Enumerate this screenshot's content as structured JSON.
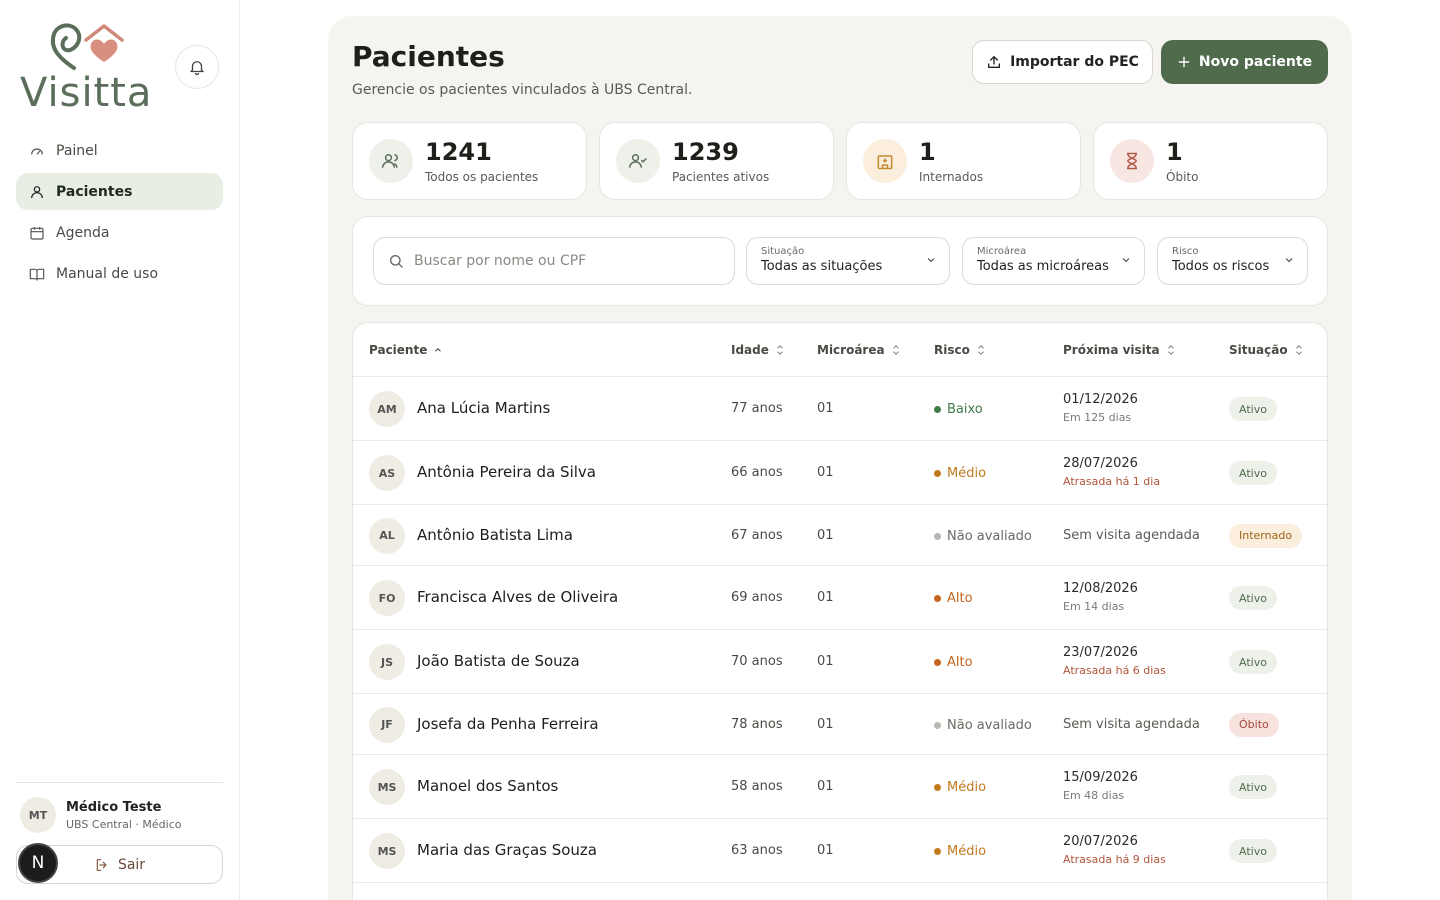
{
  "app": {
    "name": "Visitta"
  },
  "colors": {
    "accent": "#4f6b4b",
    "late": "#b0553a",
    "baixo": "#3f7a4a",
    "medio": "#c07a1e",
    "alto": "#c4641e",
    "nao": "#b8b6b0"
  },
  "sidebar": {
    "items": [
      {
        "label": "Painel",
        "icon": "gauge-icon"
      },
      {
        "label": "Pacientes",
        "icon": "user-icon"
      },
      {
        "label": "Agenda",
        "icon": "calendar-icon"
      },
      {
        "label": "Manual de uso",
        "icon": "book-icon"
      }
    ],
    "user": {
      "initials": "MT",
      "name": "Médico Teste",
      "role": "UBS Central · Médico"
    },
    "logout_label": "Sair",
    "badge": "N"
  },
  "header": {
    "title": "Pacientes",
    "subtitle": "Gerencie os pacientes vinculados à UBS Central.",
    "import_label": "Importar do PEC",
    "new_label": "Novo paciente"
  },
  "stats": [
    {
      "value": "1241",
      "label": "Todos os pacientes"
    },
    {
      "value": "1239",
      "label": "Pacientes ativos"
    },
    {
      "value": "1",
      "label": "Internados"
    },
    {
      "value": "1",
      "label": "Óbito"
    }
  ],
  "filters": {
    "search_placeholder": "Buscar por nome ou CPF",
    "situacao": {
      "caption": "Situação",
      "value": "Todas as situações"
    },
    "microarea": {
      "caption": "Microárea",
      "value": "Todas as microáreas"
    },
    "risco": {
      "caption": "Risco",
      "value": "Todos os riscos"
    }
  },
  "table": {
    "headers": [
      "Paciente",
      "Idade",
      "Microárea",
      "Risco",
      "Próxima visita",
      "Situação"
    ],
    "rows": [
      {
        "initials": "AM",
        "name": "Ana Lúcia Martins",
        "age": "77 anos",
        "micro": "01",
        "risk": "Baixo",
        "date": "01/12/2026",
        "sub": "Em 125 dias",
        "status": "Ativo"
      },
      {
        "initials": "AS",
        "name": "Antônia Pereira da Silva",
        "age": "66 anos",
        "micro": "01",
        "risk": "Médio",
        "date": "28/07/2026",
        "sub": "Atrasada há 1 dia",
        "status": "Ativo"
      },
      {
        "initials": "AL",
        "name": "Antônio Batista Lima",
        "age": "67 anos",
        "micro": "01",
        "risk": "Não avaliado",
        "date": "Sem visita agendada",
        "sub": "",
        "status": "Internado"
      },
      {
        "initials": "FO",
        "name": "Francisca Alves de Oliveira",
        "age": "69 anos",
        "micro": "01",
        "risk": "Alto",
        "date": "12/08/2026",
        "sub": "Em 14 dias",
        "status": "Ativo"
      },
      {
        "initials": "JS",
        "name": "João Batista de Souza",
        "age": "70 anos",
        "micro": "01",
        "risk": "Alto",
        "date": "23/07/2026",
        "sub": "Atrasada há 6 dias",
        "status": "Ativo"
      },
      {
        "initials": "JF",
        "name": "Josefa da Penha Ferreira",
        "age": "78 anos",
        "micro": "01",
        "risk": "Não avaliado",
        "date": "Sem visita agendada",
        "sub": "",
        "status": "Óbito"
      },
      {
        "initials": "MS",
        "name": "Manoel dos Santos",
        "age": "58 anos",
        "micro": "01",
        "risk": "Médio",
        "date": "15/09/2026",
        "sub": "Em 48 dias",
        "status": "Ativo"
      },
      {
        "initials": "MS",
        "name": "Maria das Graças Souza",
        "age": "63 anos",
        "micro": "01",
        "risk": "Médio",
        "date": "20/07/2026",
        "sub": "Atrasada há 9 dias",
        "status": "Ativo"
      }
    ]
  }
}
